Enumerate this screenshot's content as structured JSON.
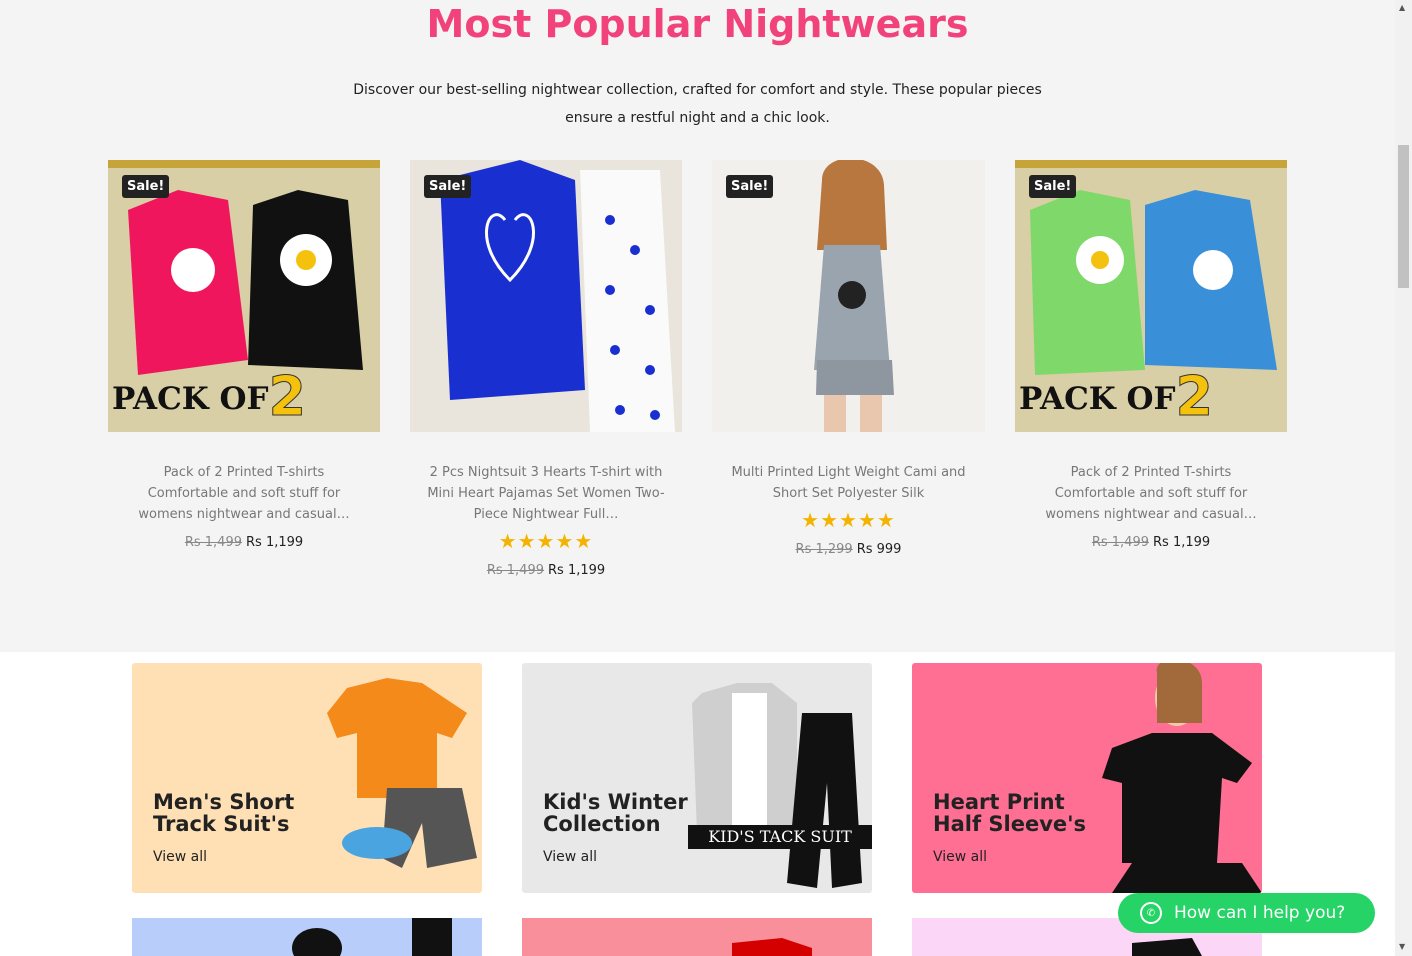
{
  "section": {
    "title": "Most Popular Nightwears",
    "description": "Discover our best-selling nightwear collection, crafted for comfort and style. These popular pieces ensure a restful night and a chic look."
  },
  "products": [
    {
      "badge": "Sale!",
      "name": "Pack of 2 Printed T-shirts Comfortable and soft stuff for womens nightwear and casual…",
      "old_price": "Rs 1,499",
      "price": "Rs 1,199",
      "rating": null,
      "overlay_text": "PACK OF",
      "overlay_num": "2"
    },
    {
      "badge": "Sale!",
      "name": "2 Pcs Nightsuit 3 Hearts T-shirt with Mini Heart Pajamas Set Women Two-Piece Nightwear Full…",
      "old_price": "Rs 1,499",
      "price": "Rs 1,199",
      "rating": "★★★★★"
    },
    {
      "badge": "Sale!",
      "name": "Multi Printed Light Weight Cami and Short Set Polyester Silk",
      "old_price": "Rs 1,299",
      "price": "Rs 999",
      "rating": "★★★★★"
    },
    {
      "badge": "Sale!",
      "name": "Pack of 2 Printed T-shirts Comfortable and soft stuff for womens nightwear and casual…",
      "old_price": "Rs 1,499",
      "price": "Rs 1,199",
      "rating": null,
      "overlay_text": "PACK OF",
      "overlay_num": "2"
    }
  ],
  "categories": [
    {
      "title": "Men's Short Track Suit's",
      "link": "View all",
      "bg": "#ffe0b5"
    },
    {
      "title": "Kid's Winter Collection",
      "link": "View all",
      "bg": "#e8e8e8",
      "overlay": "KID'S TACK SUIT"
    },
    {
      "title": "Heart Print Half Sleeve's",
      "link": "View all",
      "bg": "#ff6f93"
    }
  ],
  "whatsapp": {
    "label": "How can I help you?"
  },
  "colors": {
    "accent": "#f2427c",
    "whatsapp": "#25d366",
    "star": "#f5b301"
  }
}
